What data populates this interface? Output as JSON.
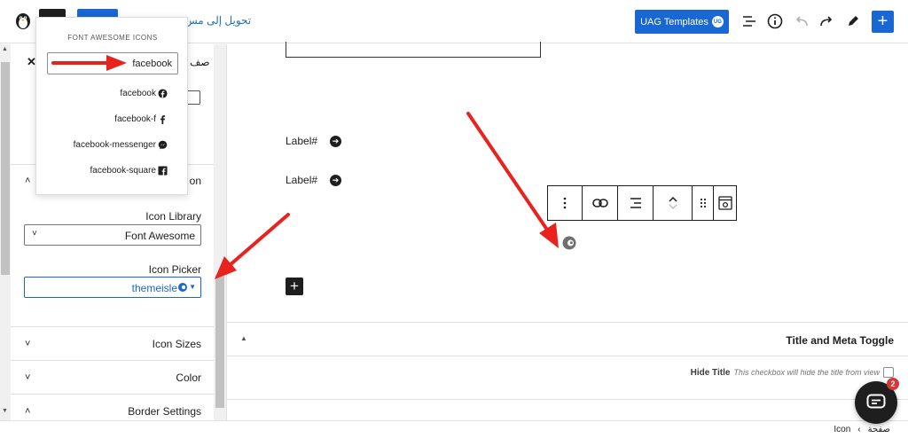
{
  "topbar": {
    "rtl_link": "تحويل إلى مس",
    "uag_button": "UAG Templates",
    "uag_badge": "UG",
    "add_button": "+"
  },
  "sidebar": {
    "close": "✕",
    "section_top_partial": "صف",
    "section_icon_partial": "on",
    "icon_library_label": "Icon Library",
    "icon_library_value": "Font Awesome",
    "icon_picker_label": "Icon Picker",
    "icon_picker_value": "themeisle",
    "panels": [
      {
        "label": "Icon Sizes"
      },
      {
        "label": "Color"
      },
      {
        "label": "Border Settings"
      }
    ]
  },
  "fa_dropdown": {
    "heading": "FONT AWESOME ICONS",
    "search_value": "facebook",
    "results": [
      {
        "label": "facebook",
        "icon": "facebook-circle-icon"
      },
      {
        "label": "facebook-f",
        "icon": "facebook-f-icon"
      },
      {
        "label": "facebook-messenger",
        "icon": "messenger-icon"
      },
      {
        "label": "facebook-square",
        "icon": "facebook-square-icon"
      }
    ]
  },
  "canvas": {
    "labels": [
      "Label#",
      "Label#"
    ],
    "add_block": "+"
  },
  "meta": {
    "title": "Title and Meta Toggle",
    "hide_title_label": "Hide Title",
    "hide_title_desc": "This checkbox will hide the title from view"
  },
  "chat": {
    "count": "2"
  },
  "breadcrumb": {
    "items": [
      "صفحة",
      "Icon"
    ]
  },
  "colors": {
    "primary": "#1967d2",
    "dark": "#1e1e1e",
    "annotation_red": "#e8231e",
    "badge_red": "#d63638"
  }
}
